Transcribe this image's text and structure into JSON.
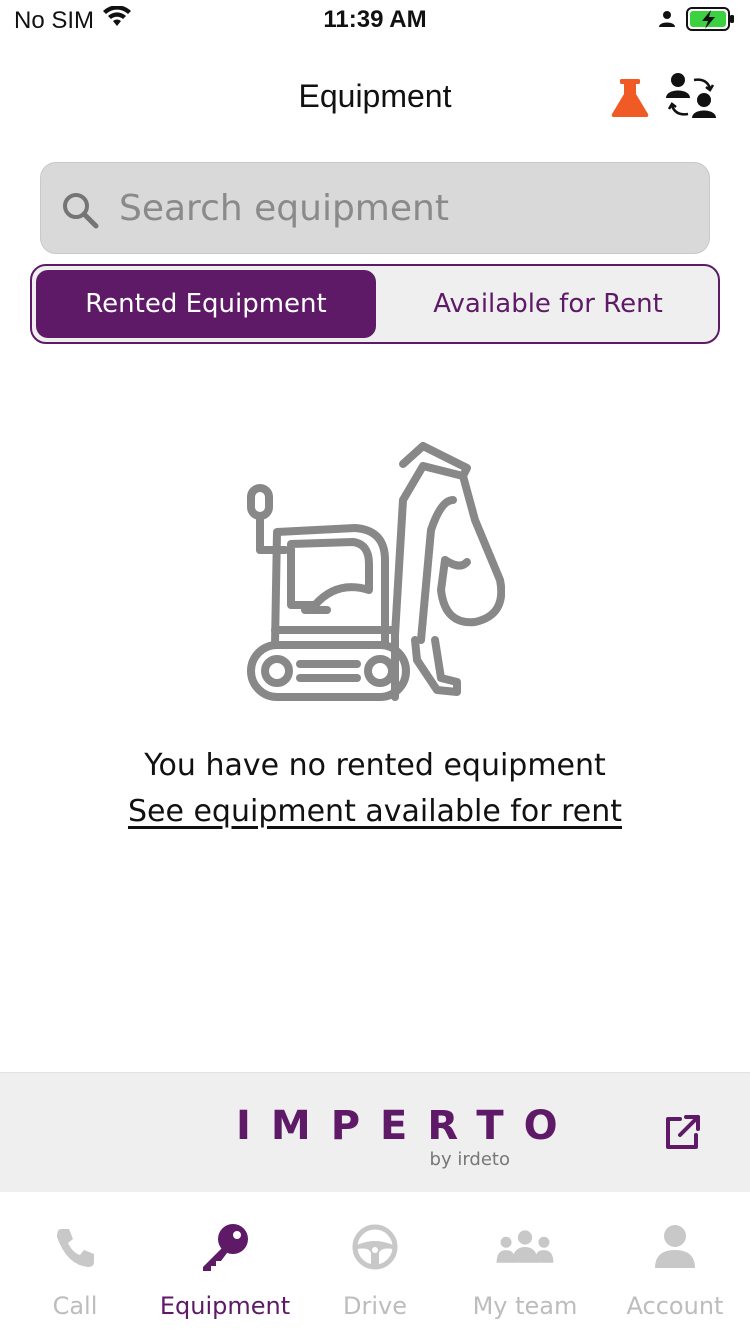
{
  "status_bar": {
    "carrier": "No SIM",
    "time": "11:39 AM"
  },
  "header": {
    "title": "Equipment",
    "icons": [
      "flask-icon",
      "swap-users-icon"
    ]
  },
  "search": {
    "placeholder": "Search equipment",
    "value": ""
  },
  "tabs": [
    {
      "label": "Rented Equipment",
      "active": true
    },
    {
      "label": "Available for Rent",
      "active": false
    }
  ],
  "empty_state": {
    "message": "You have no rented equipment",
    "link": "See equipment available for rent",
    "icon": "excavator-icon"
  },
  "brand": {
    "name": "IMPERTO",
    "sub": "by irdeto"
  },
  "nav": [
    {
      "label": "Call",
      "icon": "phone-icon",
      "active": false
    },
    {
      "label": "Equipment",
      "icon": "key-icon",
      "active": true
    },
    {
      "label": "Drive",
      "icon": "steering-wheel-icon",
      "active": false
    },
    {
      "label": "My team",
      "icon": "team-icon",
      "active": false
    },
    {
      "label": "Account",
      "icon": "person-icon",
      "active": false
    }
  ],
  "colors": {
    "accent": "#5e1a66",
    "flask": "#f05a24",
    "inactive_nav": "#bdbdbd",
    "battery": "#3bd140"
  }
}
